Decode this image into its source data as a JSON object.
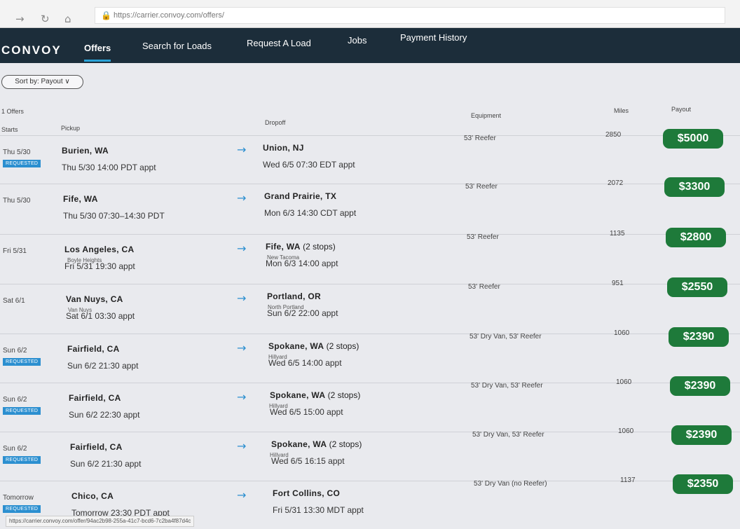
{
  "browser": {
    "url": "https://carrier.convoy.com/offers/",
    "status_url": "https://carrier.convoy.com/offer/94ac2b98-255a-41c7-bcd6-7c2ba4f87d4c",
    "icons": {
      "forward": "forward-arrow-icon",
      "refresh": "refresh-icon",
      "home": "home-icon",
      "lock": "lock-icon"
    }
  },
  "nav": {
    "logo": "CONVOY",
    "tabs": [
      "Offers",
      "Search for Loads",
      "Request A Load",
      "Jobs",
      "Payment History"
    ],
    "active_tab": "Offers"
  },
  "sort": {
    "label": "Sort by: Payout ∨"
  },
  "list": {
    "count_label": "1 Offers",
    "headers": {
      "starts": "Starts",
      "pickup": "Pickup",
      "dropoff": "Dropoff",
      "equipment": "Equipment",
      "miles": "Miles",
      "payout": "Payout"
    }
  },
  "offers": [
    {
      "starts": "Thu 5/30",
      "badge": "REQUESTED",
      "pickup_city": "Burien, WA",
      "pickup_sub": "",
      "pickup_time": "Thu 5/30 14:00 PDT appt",
      "drop_city": "Union, NJ",
      "drop_stops": "",
      "drop_sub": "",
      "drop_time": "Wed 6/5 07:30 EDT appt",
      "equipment": "53' Reefer",
      "miles": "2850",
      "payout": "$5000"
    },
    {
      "starts": "Thu 5/30",
      "badge": "",
      "pickup_city": "Fife, WA",
      "pickup_sub": "",
      "pickup_time": "Thu 5/30 07:30–14:30 PDT",
      "drop_city": "Grand Prairie, TX",
      "drop_stops": "",
      "drop_sub": "",
      "drop_time": "Mon 6/3 14:30 CDT appt",
      "equipment": "53' Reefer",
      "miles": "2072",
      "payout": "$3300"
    },
    {
      "starts": "Fri 5/31",
      "badge": "",
      "pickup_city": "Los Angeles, CA",
      "pickup_sub": "Boyle Heights",
      "pickup_time": "Fri 5/31 19:30 appt",
      "drop_city": "Fife, WA",
      "drop_stops": " (2 stops)",
      "drop_sub": "New Tacoma",
      "drop_time": "Mon 6/3 14:00 appt",
      "equipment": "53' Reefer",
      "miles": "1135",
      "payout": "$2800"
    },
    {
      "starts": "Sat 6/1",
      "badge": "",
      "pickup_city": "Van Nuys, CA",
      "pickup_sub": "Van Nuys",
      "pickup_time": "Sat 6/1 03:30 appt",
      "drop_city": "Portland, OR",
      "drop_stops": "",
      "drop_sub": "North Portland",
      "drop_time": "Sun 6/2 22:00 appt",
      "equipment": "53' Reefer",
      "miles": "951",
      "payout": "$2550"
    },
    {
      "starts": "Sun 6/2",
      "badge": "REQUESTED",
      "pickup_city": "Fairfield, CA",
      "pickup_sub": "",
      "pickup_time": "Sun 6/2 21:30 appt",
      "drop_city": "Spokane, WA",
      "drop_stops": " (2 stops)",
      "drop_sub": "Hillyard",
      "drop_time": "Wed 6/5 14:00 appt",
      "equipment": "53' Dry Van, 53' Reefer",
      "miles": "1060",
      "payout": "$2390"
    },
    {
      "starts": "Sun 6/2",
      "badge": "REQUESTED",
      "pickup_city": "Fairfield, CA",
      "pickup_sub": "",
      "pickup_time": "Sun 6/2 22:30 appt",
      "drop_city": "Spokane, WA",
      "drop_stops": " (2 stops)",
      "drop_sub": "Hillyard",
      "drop_time": "Wed 6/5 15:00 appt",
      "equipment": "53' Dry Van, 53' Reefer",
      "miles": "1060",
      "payout": "$2390"
    },
    {
      "starts": "Sun 6/2",
      "badge": "REQUESTED",
      "pickup_city": "Fairfield, CA",
      "pickup_sub": "",
      "pickup_time": "Sun 6/2 21:30 appt",
      "drop_city": "Spokane, WA",
      "drop_stops": " (2 stops)",
      "drop_sub": "Hillyard",
      "drop_time": "Wed 6/5 16:15 appt",
      "equipment": "53' Dry Van, 53' Reefer",
      "miles": "1060",
      "payout": "$2390"
    },
    {
      "starts": "Tomorrow",
      "badge": "REQUESTED",
      "pickup_city": "Chico, CA",
      "pickup_sub": "",
      "pickup_time": "Tomorrow 23:30 PDT appt",
      "drop_city": "Fort Collins, CO",
      "drop_stops": "",
      "drop_sub": "",
      "drop_time": "Fri 5/31 13:30 MDT appt",
      "equipment": "53' Dry Van (no Reefer)",
      "miles": "1137",
      "payout": "$2350"
    }
  ],
  "colors": {
    "nav_bg": "#1c2d3a",
    "payout_bg": "#1e7a3a",
    "badge_bg": "#2b8fd0",
    "accent": "#2aa3d8"
  }
}
